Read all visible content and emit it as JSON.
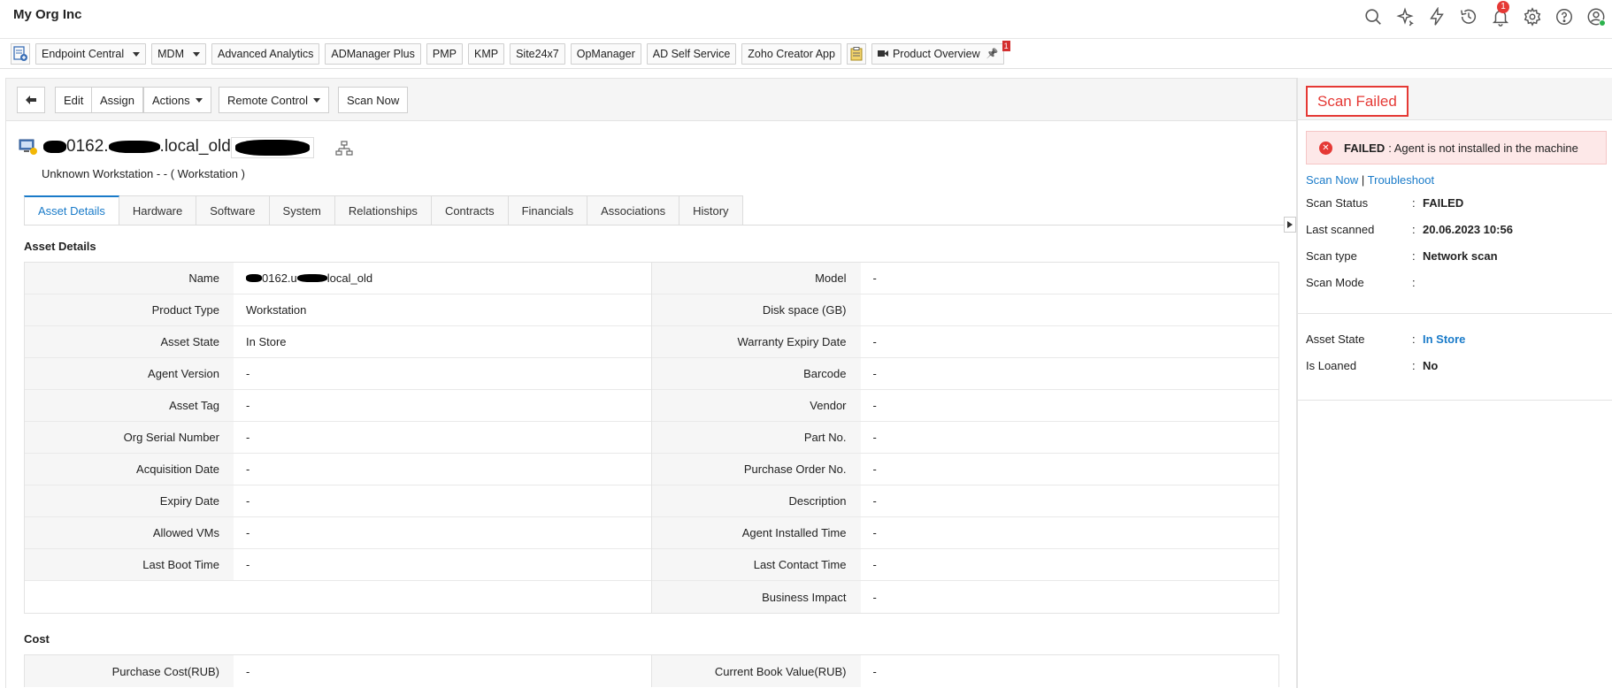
{
  "header": {
    "org_name": "My Org Inc",
    "notification_count": "1"
  },
  "productbar": {
    "items": [
      {
        "label": "Endpoint Central",
        "dropdown": true
      },
      {
        "label": "MDM",
        "dropdown": true
      },
      {
        "label": "Advanced Analytics"
      },
      {
        "label": "ADManager Plus"
      },
      {
        "label": "PMP"
      },
      {
        "label": "KMP"
      },
      {
        "label": "Site24x7"
      },
      {
        "label": "OpManager"
      },
      {
        "label": "AD Self Service"
      },
      {
        "label": "Zoho Creator App"
      }
    ],
    "overview_label": "Product Overview",
    "overview_badge": "1"
  },
  "actions": {
    "edit": "Edit",
    "assign": "Assign",
    "actions": "Actions",
    "remote_control": "Remote Control",
    "scan_now": "Scan Now"
  },
  "asset": {
    "name_mid": "0162.",
    "name_suffix": ".local_old",
    "subtitle": "Unknown Workstation - - ( Workstation )"
  },
  "tabs": [
    "Asset Details",
    "Hardware",
    "Software",
    "System",
    "Relationships",
    "Contracts",
    "Financials",
    "Associations",
    "History"
  ],
  "details": {
    "title": "Asset Details",
    "left": [
      {
        "label": "Name",
        "value": "0162.u",
        "value_suffix": "local_old",
        "redacted": true
      },
      {
        "label": "Product Type",
        "value": "Workstation"
      },
      {
        "label": "Asset State",
        "value": "In Store"
      },
      {
        "label": "Agent Version",
        "value": "-"
      },
      {
        "label": "Asset Tag",
        "value": "-"
      },
      {
        "label": "Org Serial Number",
        "value": "-"
      },
      {
        "label": "Acquisition Date",
        "value": "-"
      },
      {
        "label": "Expiry Date",
        "value": "-"
      },
      {
        "label": "Allowed VMs",
        "value": "-"
      },
      {
        "label": "Last Boot Time",
        "value": "-"
      }
    ],
    "right": [
      {
        "label": "Model",
        "value": "-"
      },
      {
        "label": "Disk space (GB)",
        "value": ""
      },
      {
        "label": "Warranty Expiry Date",
        "value": "-"
      },
      {
        "label": "Barcode",
        "value": "-"
      },
      {
        "label": "Vendor",
        "value": "-"
      },
      {
        "label": "Part No.",
        "value": "-"
      },
      {
        "label": "Purchase Order No.",
        "value": "-"
      },
      {
        "label": "Description",
        "value": "-"
      },
      {
        "label": "Agent Installed Time",
        "value": "-"
      },
      {
        "label": "Last Contact Time",
        "value": "-"
      },
      {
        "label": "Business Impact",
        "value": "-"
      }
    ]
  },
  "cost": {
    "title": "Cost",
    "left": [
      {
        "label": "Purchase Cost(RUB)",
        "value": "-"
      }
    ],
    "right": [
      {
        "label": "Current Book Value(RUB)",
        "value": "-"
      }
    ]
  },
  "side": {
    "status_title": "Scan Failed",
    "alert_strong": "FAILED",
    "alert_text": ": Agent is not installed in the machine",
    "link_scan_now": "Scan Now",
    "link_separator": "|",
    "link_troubleshoot": "Troubleshoot",
    "scan_info": [
      {
        "key": "Scan Status",
        "value": "FAILED"
      },
      {
        "key": "Last scanned",
        "value": "20.06.2023 10:56"
      },
      {
        "key": "Scan type",
        "value": "Network scan"
      },
      {
        "key": "Scan Mode",
        "value": ""
      }
    ],
    "state_info": [
      {
        "key": "Asset State",
        "value": "In Store",
        "link": true
      },
      {
        "key": "Is Loaned",
        "value": "No"
      }
    ],
    "colon": ":"
  },
  "colors": {
    "accent": "#1a7bc9",
    "error": "#e53935",
    "error_bg": "#fde8e8"
  }
}
